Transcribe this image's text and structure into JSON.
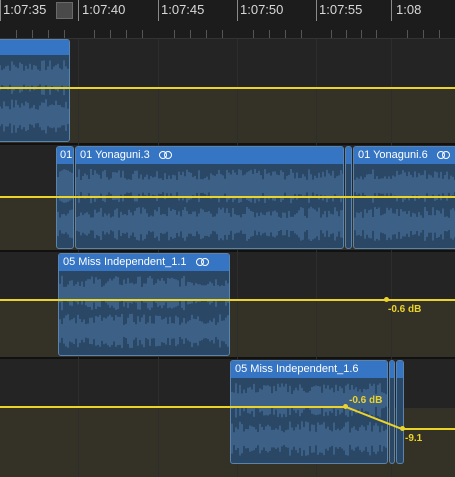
{
  "timeline": {
    "ruler_labels": [
      "1:07:35",
      "1:07:40",
      "1:07:45",
      "1:07:50",
      "1:07:55",
      "1:08"
    ]
  },
  "clips": {
    "track2_left": "01",
    "track2_main": "01 Yonaguni.3",
    "track2_right": "01 Yonaguni.6",
    "track3": "05 Miss Independent_1.1",
    "track4": "05 Miss Independent_1.6"
  },
  "volume_labels": {
    "track3_point": "-0.6 dB",
    "track4_point1": "-0.6 dB",
    "track4_point2": "-9.1"
  },
  "colors": {
    "clip_header": "#3575c3",
    "clip_body": "#2a4766",
    "volume_line": "#ecd32a",
    "lane_dim": "#343126"
  }
}
